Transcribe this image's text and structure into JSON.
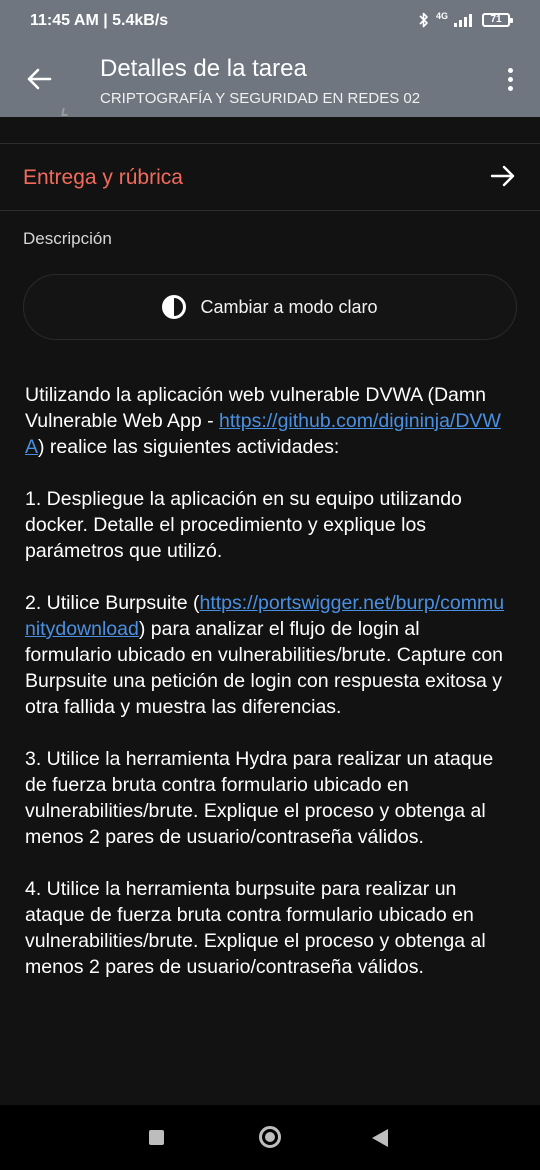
{
  "status_bar": {
    "time_speed": "11:45 AM | 5.4kB/s",
    "network_label": "4G",
    "battery_level": "71",
    "icons": [
      "bluetooth-icon",
      "signal-icon",
      "battery-icon"
    ]
  },
  "app_bar": {
    "title": "Detalles de la tarea",
    "subtitle": "CRIPTOGRAFÍA Y SEGURIDAD EN REDES 02",
    "background_color": "#6f7680"
  },
  "entrega_row": {
    "label": "Entrega y rúbrica",
    "label_color": "#f16b5c"
  },
  "description": {
    "label": "Descripción",
    "theme_toggle_label": "Cambiar a modo claro",
    "paragraphs": {
      "p1_before": "Utilizando la aplicación web vulnerable DVWA (Damn Vulnerable Web App - ",
      "p1_link": "https://github.com/digininja/DVWA",
      "p1_after": ") realice las siguientes actividades:",
      "p2": "1. Despliegue la aplicación en su equipo utilizando docker. Detalle el procedimiento y explique los parámetros que utilizó.",
      "p3_before": "2. Utilice Burpsuite (",
      "p3_link": "https://portswigger.net/burp/communitydownload",
      "p3_after": ") para analizar el flujo de login al formulario ubicado en vulnerabilities/brute. Capture con Burpsuite una petición de login con respuesta exitosa y otra fallida y muestra las diferencias.",
      "p4": "3. Utilice la herramienta Hydra para realizar un ataque de fuerza bruta contra formulario ubicado en vulnerabilities/brute. Explique el proceso y obtenga al menos 2 pares de usuario/contraseña válidos.",
      "p5": "4. Utilice la herramienta burpsuite para realizar un ataque de fuerza bruta contra formulario ubicado en vulnerabilities/brute. Explique el proceso y obtenga al menos 2 pares de usuario/contraseña válidos."
    },
    "link_color": "#4a90e2"
  },
  "nav_bar": {
    "buttons": [
      "recents-button",
      "home-button",
      "back-button"
    ]
  }
}
